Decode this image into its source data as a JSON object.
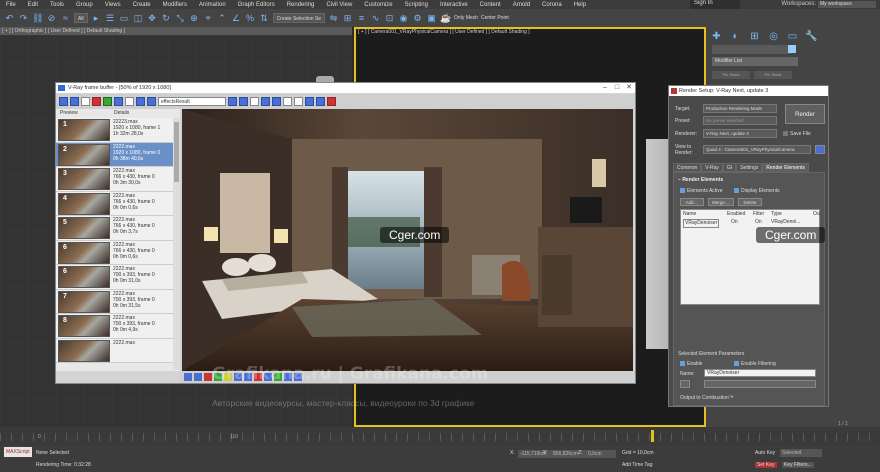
{
  "menubar": {
    "items": [
      "File",
      "Edit",
      "Tools",
      "Group",
      "Views",
      "Create",
      "Modifiers",
      "Animation",
      "Graph Editors",
      "Rendering",
      "Civil View",
      "Customize",
      "Scripting",
      "Interactive",
      "Content",
      "Arnold",
      "Corona",
      "Help"
    ],
    "sign_in": "Sign In",
    "workspaces_label": "Workspaces:",
    "workspace_value": "My workspace"
  },
  "toolbar": {
    "filter_value": "All",
    "selection_set": "Create Selection Se",
    "only_mesh": "Only Mesh",
    "center_point": "Center Point"
  },
  "viewports": {
    "left_label": "[ + ] [ Orthographic ] [ User Defined ] [ Default Shading ]",
    "right_label": "[ + ] [ Camera001_VRayPhysicalCamera ] [ User Defined ] [ Default Shading ]"
  },
  "command_panel": {
    "modifier_list": "Modifier List",
    "tabs": [
      "Pin Stack",
      "Pin Stack"
    ]
  },
  "frame_buffer": {
    "title": "V-Ray frame buffer - [50% of 1920 x 1080]",
    "channel": "effectsResult",
    "history_headers": {
      "preview": "Preview",
      "details": "Details"
    },
    "history": [
      {
        "num": "1",
        "text": "22223.max\n1920 x 1080, frame 1\n1h 32m 28,0s",
        "selected": false
      },
      {
        "num": "2",
        "text": "2222.max\n1920 x 1080, frame 0\n0h 38m 40,6s",
        "selected": true
      },
      {
        "num": "3",
        "text": "2222.max\n766 x 430, frame 0\n0h 3m 30,0s",
        "selected": false
      },
      {
        "num": "4",
        "text": "2222.max\n766 x 430, frame 0\n0h 0m 0,6s",
        "selected": false
      },
      {
        "num": "5",
        "text": "2222.max\n766 x 430, frame 0\n0h 0m 3,7s",
        "selected": false
      },
      {
        "num": "6",
        "text": "2222.max\n766 x 430, frame 0\n0h 0m 0,6s",
        "selected": false
      },
      {
        "num": "6",
        "text": "2222.max\n700 x 393, frame 0\n0h 0m 31,0s",
        "selected": false
      },
      {
        "num": "7",
        "text": "2222.max\n700 x 393, frame 0\n0h 0m 31,5s",
        "selected": false
      },
      {
        "num": "8",
        "text": "2222.max\n700 x 393, frame 0\n0h 0m 4,9s",
        "selected": false
      },
      {
        "num": "",
        "text": "2222.max",
        "selected": false
      }
    ]
  },
  "render_setup": {
    "title": "Render Setup: V-Ray Next, update 3",
    "target_label": "Target:",
    "target_value": "Production Rendering Mode",
    "preset_label": "Preset:",
    "preset_value": "No preset selected",
    "renderer_label": "Renderer:",
    "renderer_value": "V-Ray Next, update 3",
    "save_file": "Save File",
    "view_label": "View to\nRender:",
    "view_value": "Quad 4 - Camera001_VRayPhysicalCamera",
    "render_button": "Render",
    "tabs": [
      "Common",
      "V-Ray",
      "GI",
      "Settings",
      "Render Elements"
    ],
    "section": "Render Elements",
    "elements_active": "Elements Active",
    "display_elements": "Display Elements",
    "add": "Add ...",
    "merge": "Merge ...",
    "delete": "Delete",
    "table_headers": [
      "Name",
      "Enabled",
      "Filter",
      "Type",
      "Ou"
    ],
    "row": [
      "VRayDenoiser",
      "On",
      "On",
      "VRayDenoi..."
    ],
    "selected_params": "Selected Element Parameters",
    "enable": "Enable",
    "enable_filtering": "Enable Filtering",
    "name_label": "Name:",
    "name_value": "VRayDenoiser",
    "output_composer": "Output to Combustion™"
  },
  "timeline": {
    "start": "0",
    "mid": "110",
    "frame_counter": "1 / 1"
  },
  "status": {
    "maxscript": "MAXScript",
    "none_selected": "None Selected",
    "rendering_time": "Rendering Time: 0:32:28",
    "x_label": "X:",
    "x_value": "-115,719cm",
    "y_label": "Y:",
    "y_value": "856,826cm",
    "z_label": "Z:",
    "z_value": "0,0cm",
    "grid": "Grid = 10,0cm",
    "add_time_tag": "Add Time Tag",
    "auto_key": "Auto Key",
    "selected": "Selected",
    "set_key": "Set Key",
    "key_filters": "Key Filters..."
  },
  "watermarks": {
    "cger1": "Cger.com",
    "cger2": "Cger.com",
    "site": "Grafikana.ru | Grafikana.com",
    "tagline": "Авторские видеокурсы, мастер-классы, видеоуроки по 3d графике"
  }
}
